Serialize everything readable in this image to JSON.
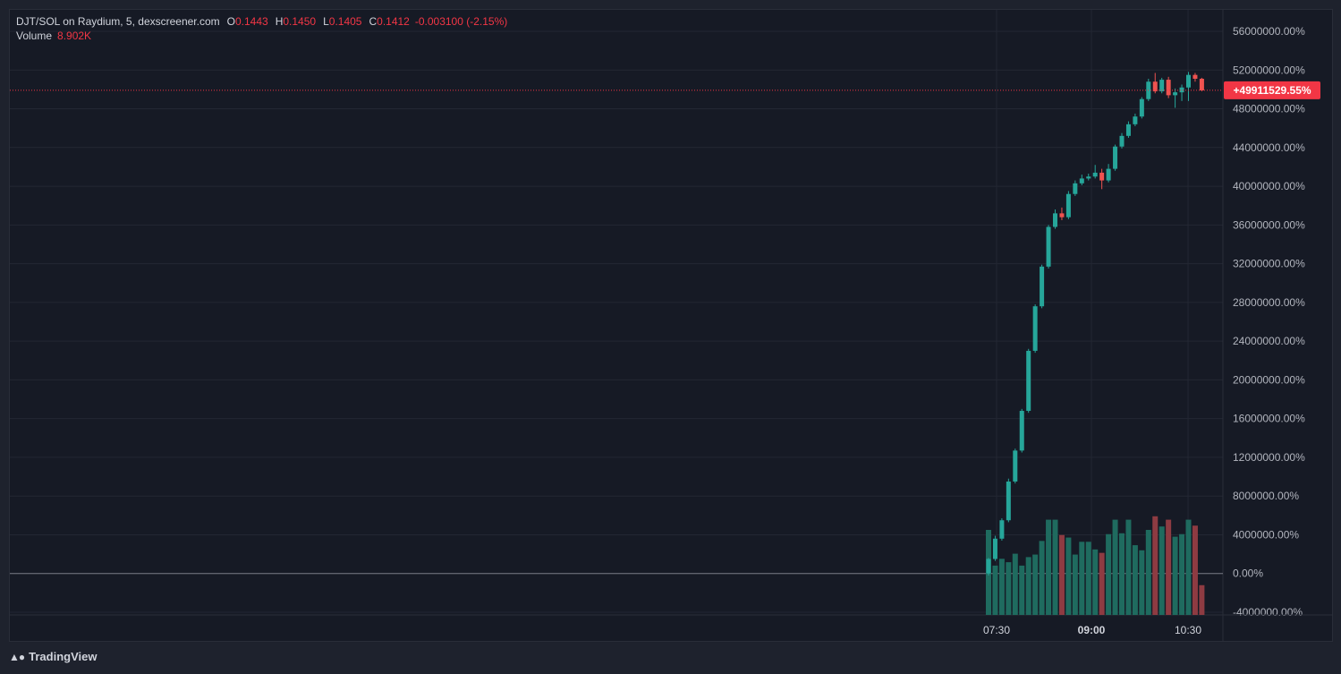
{
  "header": {
    "symbol": "DJT/SOL on Raydium, 5, dexscreener.com",
    "o_label": "O",
    "o": "0.1443",
    "h_label": "H",
    "h": "0.1450",
    "l_label": "L",
    "l": "0.1405",
    "c_label": "C",
    "c": "0.1412",
    "change": "-0.003100 (-2.15%)",
    "volume_label": "Volume",
    "volume": "8.902K"
  },
  "footer": {
    "brand": "TradingView",
    "logo": "tradingview-logo"
  },
  "colors": {
    "up": "#26a69a",
    "down": "#ef5350",
    "vol_up": "#1f6b5f",
    "vol_down": "#8e3b42",
    "price_tag": "#f23645"
  },
  "chart_data": {
    "type": "candlestick",
    "ylim": [
      -4000000,
      56000000
    ],
    "y_tick_labels": [
      "56000000.00%",
      "52000000.00%",
      "48000000.00%",
      "44000000.00%",
      "40000000.00%",
      "36000000.00%",
      "32000000.00%",
      "28000000.00%",
      "24000000.00%",
      "20000000.00%",
      "16000000.00%",
      "12000000.00%",
      "8000000.00%",
      "4000000.00%",
      "0.00%",
      "-4000000.00%"
    ],
    "x_tick_labels": [
      "07:30",
      "09:00",
      "10:30"
    ],
    "x_tick_bold": [
      false,
      true,
      false
    ],
    "current_value_label": "+49911529.55%",
    "current_value": 49911529.55,
    "baseline": 0,
    "candles": [
      {
        "o": 0,
        "h": 1600000,
        "l": -200000,
        "c": 1500000
      },
      {
        "o": 1500000,
        "h": 3900000,
        "l": 1300000,
        "c": 3600000
      },
      {
        "o": 3600000,
        "h": 5700000,
        "l": 3400000,
        "c": 5500000
      },
      {
        "o": 5500000,
        "h": 9800000,
        "l": 5300000,
        "c": 9500000
      },
      {
        "o": 9500000,
        "h": 12900000,
        "l": 9300000,
        "c": 12700000
      },
      {
        "o": 12700000,
        "h": 17000000,
        "l": 12500000,
        "c": 16800000
      },
      {
        "o": 16800000,
        "h": 23200000,
        "l": 16600000,
        "c": 23000000
      },
      {
        "o": 23000000,
        "h": 27800000,
        "l": 22800000,
        "c": 27600000
      },
      {
        "o": 27600000,
        "h": 31900000,
        "l": 27400000,
        "c": 31700000
      },
      {
        "o": 31700000,
        "h": 36000000,
        "l": 31500000,
        "c": 35800000
      },
      {
        "o": 35800000,
        "h": 37600000,
        "l": 35600000,
        "c": 37200000
      },
      {
        "o": 37200000,
        "h": 37800000,
        "l": 36500000,
        "c": 36800000
      },
      {
        "o": 36800000,
        "h": 39500000,
        "l": 36600000,
        "c": 39200000
      },
      {
        "o": 39200000,
        "h": 40600000,
        "l": 39000000,
        "c": 40300000
      },
      {
        "o": 40300000,
        "h": 41200000,
        "l": 40100000,
        "c": 40800000
      },
      {
        "o": 40800000,
        "h": 41300000,
        "l": 40600000,
        "c": 41000000
      },
      {
        "o": 41000000,
        "h": 42200000,
        "l": 40800000,
        "c": 41400000
      },
      {
        "o": 41400000,
        "h": 41800000,
        "l": 39700000,
        "c": 40600000
      },
      {
        "o": 40600000,
        "h": 42300000,
        "l": 40400000,
        "c": 41800000
      },
      {
        "o": 41800000,
        "h": 44300000,
        "l": 41600000,
        "c": 44100000
      },
      {
        "o": 44100000,
        "h": 45500000,
        "l": 43900000,
        "c": 45200000
      },
      {
        "o": 45200000,
        "h": 46700000,
        "l": 45000000,
        "c": 46400000
      },
      {
        "o": 46400000,
        "h": 47500000,
        "l": 46200000,
        "c": 47200000
      },
      {
        "o": 47200000,
        "h": 49200000,
        "l": 47000000,
        "c": 49000000
      },
      {
        "o": 49000000,
        "h": 51100000,
        "l": 48800000,
        "c": 50800000
      },
      {
        "o": 50800000,
        "h": 51700000,
        "l": 49600000,
        "c": 49800000
      },
      {
        "o": 49800000,
        "h": 51200000,
        "l": 49600000,
        "c": 51000000
      },
      {
        "o": 51000000,
        "h": 51300000,
        "l": 49100000,
        "c": 49400000
      },
      {
        "o": 49400000,
        "h": 50100000,
        "l": 48100000,
        "c": 49700000
      },
      {
        "o": 49700000,
        "h": 50500000,
        "l": 48800000,
        "c": 50200000
      },
      {
        "o": 50200000,
        "h": 51800000,
        "l": 48800000,
        "c": 51500000
      },
      {
        "o": 51500000,
        "h": 51700000,
        "l": 50800000,
        "c": 51100000
      },
      {
        "o": 51100000,
        "h": 51200000,
        "l": 49800000,
        "c": 49900000
      }
    ],
    "volume_up": [
      1,
      1,
      1,
      1,
      1,
      1,
      1,
      1,
      1,
      1,
      1,
      0,
      1,
      1,
      1,
      1,
      1,
      0,
      1,
      1,
      1,
      1,
      1,
      1,
      1,
      0,
      1,
      0,
      1,
      1,
      1,
      0,
      0
    ],
    "volume_relative": [
      1.0,
      0.58,
      0.66,
      0.62,
      0.72,
      0.58,
      0.68,
      0.71,
      0.87,
      1.12,
      1.12,
      0.94,
      0.91,
      0.71,
      0.86,
      0.86,
      0.77,
      0.73,
      0.95,
      1.12,
      0.96,
      1.12,
      0.82,
      0.76,
      1.0,
      1.16,
      1.04,
      1.12,
      0.92,
      0.95,
      1.12,
      1.05,
      0.35
    ]
  }
}
